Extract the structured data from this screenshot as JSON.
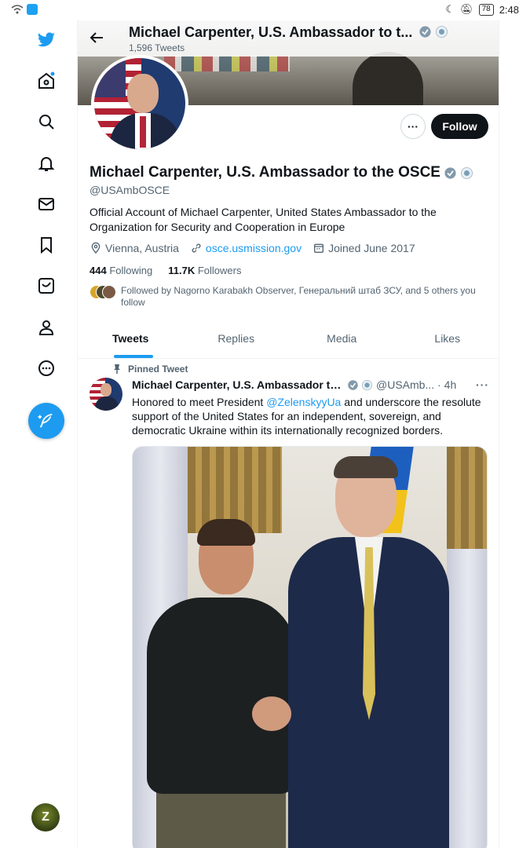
{
  "status_bar": {
    "time": "2:48",
    "battery": "78"
  },
  "nav": {
    "items": [
      "twitter-logo",
      "home",
      "explore",
      "notifications",
      "messages",
      "bookmarks",
      "twitter-blue",
      "profile",
      "more"
    ],
    "compose_label": "Tweet",
    "accent": "#1d9bf0"
  },
  "header": {
    "title": "Michael Carpenter, U.S. Ambassador to t...",
    "tweet_count": "1,596 Tweets"
  },
  "profile": {
    "name": "Michael Carpenter, U.S. Ambassador to the OSCE",
    "handle": "@USAmbOSCE",
    "bio": "Official Account of Michael Carpenter, United States Ambassador to the Organization for Security and Cooperation in Europe",
    "location": "Vienna, Austria",
    "website": "osce.usmission.gov",
    "joined": "Joined June 2017",
    "following_count": "444",
    "following_label": "Following",
    "followers_count": "11.7K",
    "followers_label": "Followers",
    "followed_by": "Followed by Nagorno Karabakh Observer, Генеральний штаб ЗСУ, and 5 others you follow",
    "follow_label": "Follow",
    "more_label": "···"
  },
  "tabs": [
    {
      "label": "Tweets",
      "active": true
    },
    {
      "label": "Replies",
      "active": false
    },
    {
      "label": "Media",
      "active": false
    },
    {
      "label": "Likes",
      "active": false
    }
  ],
  "tweet": {
    "pinned_label": "Pinned Tweet",
    "author": "Michael Carpenter, U.S. Ambassador to ...",
    "handle": "@USAmb...",
    "time": "· 4h",
    "more": "···",
    "text_before": "Honored to meet President ",
    "mention": "@ZelenskyyUa",
    "text_after": " and underscore the resolute support of the United States for an independent, sovereign, and democratic Ukraine within its internationally recognized borders."
  },
  "account_avatar_letter": "Z"
}
